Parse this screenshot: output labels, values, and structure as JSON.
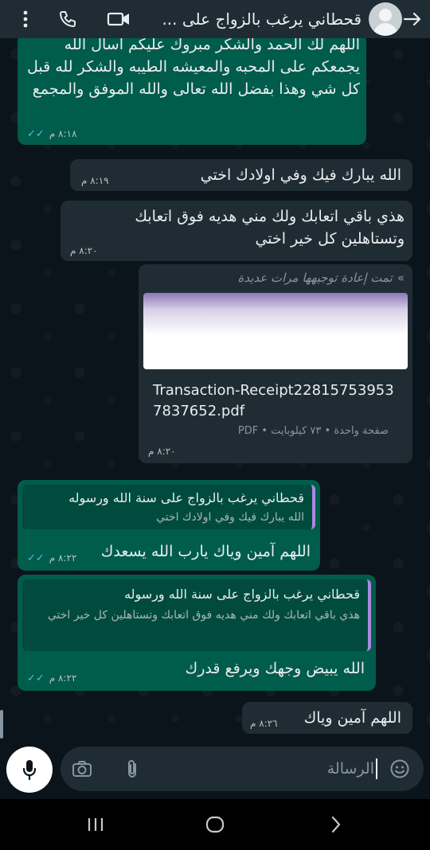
{
  "header": {
    "title": "قحطاني يرغب بالزواج على ..."
  },
  "messages": [
    {
      "text": "اللهم لك الحمد والشكر مبروك عليكم اسأل الله يجمعكم على المحبه والمعيشه الطيبه والشكر لله قبل كل شي وهذا بفضل الله تعالى والله الموفق والمجمع",
      "time": "٨:١٨ م"
    },
    {
      "text": "الله يبارك فيك وفي اولادك اختي",
      "time": "٨:١٩ م"
    },
    {
      "text": "هذي باقي اتعابك ولك مني هديه فوق اتعابك وتستاهلين كل خير اختي",
      "time": "٨:٢٠ م"
    },
    {
      "forwarded": "تمت إعادة توجيهها مرات عديدة",
      "file_name": "Transaction-Receipt228157539537837652.pdf",
      "file_info": "صفحة واحدة • ٧٣ كيلوبايت • PDF",
      "time": "٨:٢٠ م"
    },
    {
      "quote_title": "قحطاني يرغب بالزواج على سنة الله ورسوله",
      "quote_text": "الله يبارك فيك وفي اولادك اختي",
      "text": "اللهم آمين وياك يارب الله يسعدك",
      "time": "٨:٢٢ م"
    },
    {
      "quote_title": "قحطاني يرغب بالزواج على سنة الله ورسوله",
      "quote_text": "هذي باقي اتعابك ولك مني هديه فوق اتعابك وتستاهلين كل خير اختي",
      "text": "الله يبيض وجهك ويرفع قدرك",
      "time": "٨:٢٢ م"
    },
    {
      "text": "اللهم آمين وياك",
      "time": "٨:٢٦ م"
    }
  ],
  "composer": {
    "placeholder": "الرسالة"
  },
  "colors": {
    "outgoing": "#005c4b",
    "incoming": "#202c33",
    "read_ticks": "#53bdeb",
    "header": "#1f2c34"
  }
}
